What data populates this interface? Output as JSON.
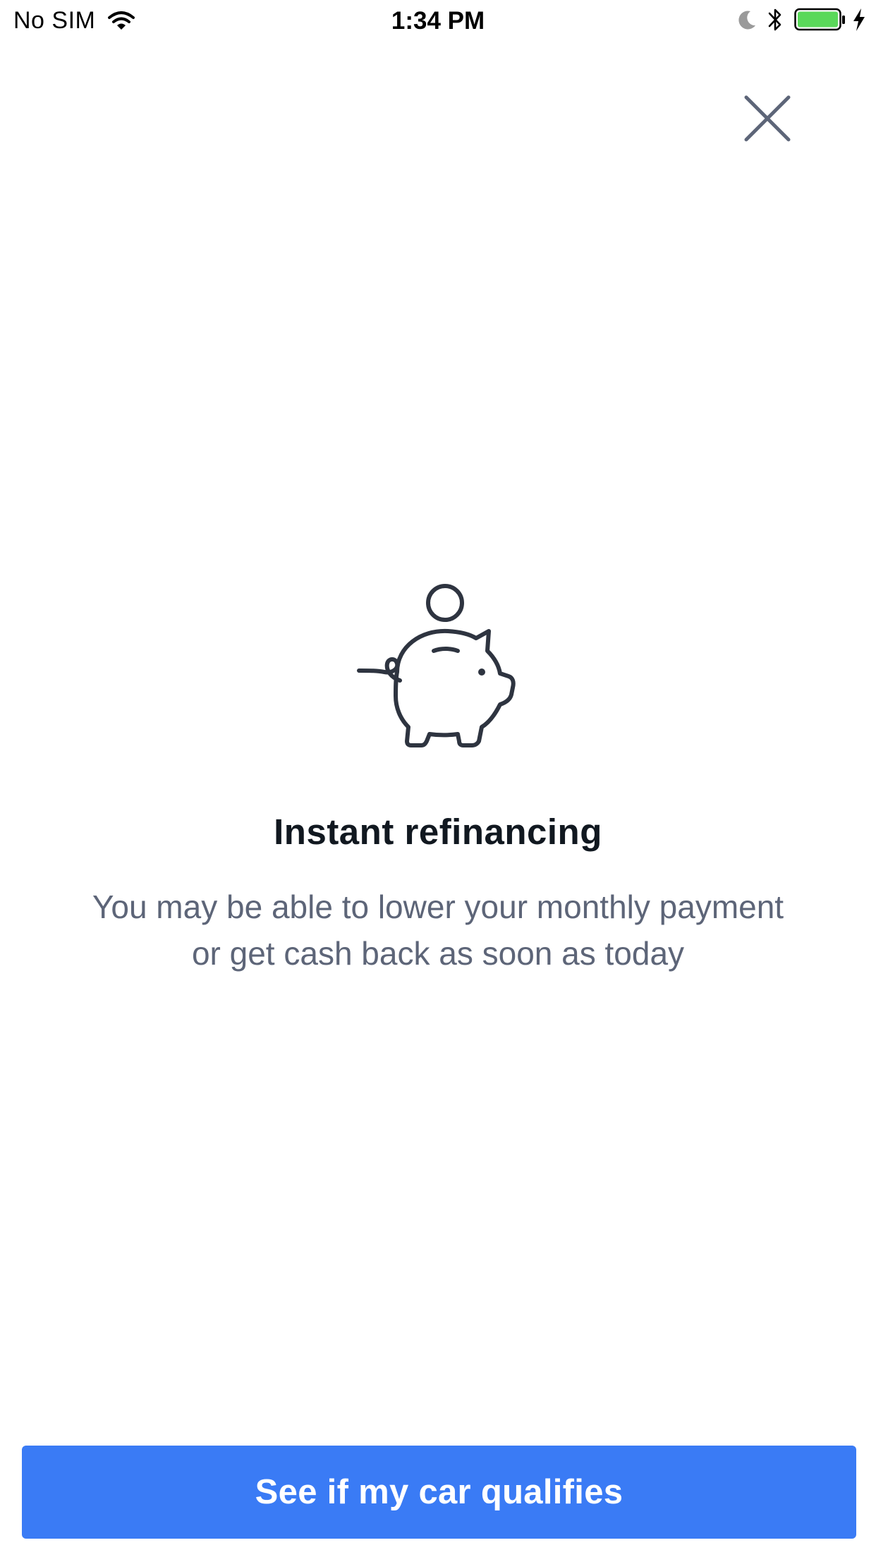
{
  "status_bar": {
    "carrier": "No SIM",
    "time": "1:34 PM",
    "icons": [
      "wifi-icon",
      "moon-icon",
      "bluetooth-icon",
      "battery-icon",
      "charging-bolt-icon"
    ],
    "battery_color": "#5ad85a"
  },
  "header": {
    "close_icon": "close-icon"
  },
  "hero": {
    "icon": "piggy-bank-icon",
    "title": "Instant refinancing",
    "subtitle_line1": "You may be able to lower your monthly payment",
    "subtitle_line2": "or get cash back as soon as today"
  },
  "cta": {
    "label": "See if my car qualifies",
    "color": "#3a7bf5"
  }
}
